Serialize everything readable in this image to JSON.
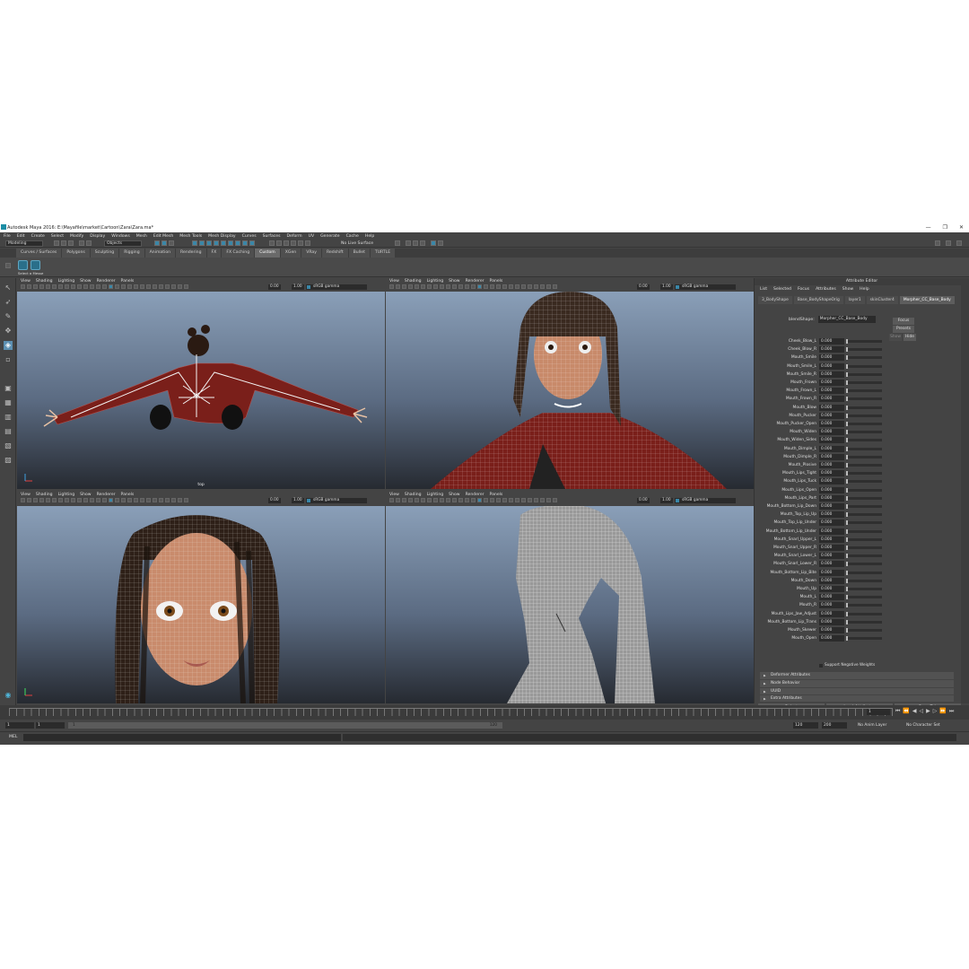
{
  "window": {
    "title": "Autodesk Maya 2016: E:\\Mayafile\\market\\Cartoon\\Zara\\Zara.ma*",
    "controls": [
      "—",
      "❐",
      "✕"
    ]
  },
  "menubar": [
    "File",
    "Edit",
    "Create",
    "Select",
    "Modify",
    "Display",
    "Windows",
    "Mesh",
    "Edit Mesh",
    "Mesh Tools",
    "Mesh Display",
    "Curves",
    "Surfaces",
    "Deform",
    "UV",
    "Generate",
    "Cache",
    "Help"
  ],
  "status": {
    "mode": "Modeling",
    "selection_mode": "Objects",
    "live_surface": "No Live Surface"
  },
  "shelf_tabs": [
    "Curves / Surfaces",
    "Polygons",
    "Sculpting",
    "Rigging",
    "Animation",
    "Rendering",
    "FX",
    "FX Caching",
    "Custom",
    "XGen",
    "VRay",
    "Redshift",
    "Bullet",
    "TURTLE"
  ],
  "shelf_active": "Custom",
  "shelf_button_label": "Select a Messe",
  "viewport_menu": [
    "View",
    "Shading",
    "Lighting",
    "Show",
    "Renderer",
    "Panels"
  ],
  "viewport_values": {
    "near": "0.00",
    "far": "1.00",
    "color_space": "sRGB gamma"
  },
  "viewports": [
    {
      "name": "top",
      "camera_label": "top"
    },
    {
      "name": "persp",
      "camera_label": ""
    },
    {
      "name": "front",
      "camera_label": ""
    },
    {
      "name": "side",
      "camera_label": ""
    }
  ],
  "attribute_editor": {
    "title": "Attribute Editor",
    "menu": [
      "List",
      "Selected",
      "Focus",
      "Attributes",
      "Show",
      "Help"
    ],
    "tabs": [
      "3_BodyShape",
      "Base_BodyShapeOrig",
      "layer1",
      "skinCluster4",
      "Morpher_CC_Base_Body"
    ],
    "active_tab": "Morpher_CC_Base_Body",
    "blendshape_label": "blendShape:",
    "blendshape_value": "Morpher_CC_Base_Body",
    "buttons": {
      "focus": "Focus",
      "presets": "Presets",
      "show": "Show",
      "hide": "Hide"
    },
    "targets": [
      {
        "name": "Cheek_Blow_L",
        "value": "0.000"
      },
      {
        "name": "Cheek_Blow_R",
        "value": "0.000"
      },
      {
        "name": "Mouth_Smile",
        "value": "0.000"
      },
      {
        "name": "Mouth_Smile_L",
        "value": "0.000"
      },
      {
        "name": "Mouth_Smile_R",
        "value": "0.000"
      },
      {
        "name": "Mouth_Frown",
        "value": "0.000"
      },
      {
        "name": "Mouth_Frown_L",
        "value": "0.000"
      },
      {
        "name": "Mouth_Frown_R",
        "value": "0.000"
      },
      {
        "name": "Mouth_Blow",
        "value": "0.000"
      },
      {
        "name": "Mouth_Pucker",
        "value": "0.000"
      },
      {
        "name": "Mouth_Pucker_Open",
        "value": "0.000"
      },
      {
        "name": "Mouth_Widen",
        "value": "0.000"
      },
      {
        "name": "Mouth_Widen_Sides",
        "value": "0.000"
      },
      {
        "name": "Mouth_Dimple_L",
        "value": "0.000"
      },
      {
        "name": "Mouth_Dimple_R",
        "value": "0.000"
      },
      {
        "name": "Mouth_Plosive",
        "value": "0.000"
      },
      {
        "name": "Mouth_Lips_Tight",
        "value": "0.000"
      },
      {
        "name": "Mouth_Lips_Tuck",
        "value": "0.000"
      },
      {
        "name": "Mouth_Lips_Open",
        "value": "0.000"
      },
      {
        "name": "Mouth_Lips_Part",
        "value": "0.000"
      },
      {
        "name": "Mouth_Bottom_Lip_Down",
        "value": "0.000"
      },
      {
        "name": "Mouth_Top_Lip_Up",
        "value": "0.000"
      },
      {
        "name": "Mouth_Top_Lip_Under",
        "value": "0.000"
      },
      {
        "name": "Mouth_Bottom_Lip_Under",
        "value": "0.000"
      },
      {
        "name": "Mouth_Snarl_Upper_L",
        "value": "0.000"
      },
      {
        "name": "Mouth_Snarl_Upper_R",
        "value": "0.000"
      },
      {
        "name": "Mouth_Snarl_Lower_L",
        "value": "0.000"
      },
      {
        "name": "Mouth_Snarl_Lower_R",
        "value": "0.000"
      },
      {
        "name": "Mouth_Bottom_Lip_Bite",
        "value": "0.000"
      },
      {
        "name": "Mouth_Down",
        "value": "0.000"
      },
      {
        "name": "Mouth_Up",
        "value": "0.000"
      },
      {
        "name": "Mouth_L",
        "value": "0.000"
      },
      {
        "name": "Mouth_R",
        "value": "0.000"
      },
      {
        "name": "Mouth_Lips_Jaw_Adjust",
        "value": "0.000"
      },
      {
        "name": "Mouth_Bottom_Lip_Trans",
        "value": "0.000"
      },
      {
        "name": "Mouth_Skewer",
        "value": "0.000"
      },
      {
        "name": "Mouth_Open",
        "value": "0.000"
      }
    ],
    "support_negative": "Support Negative Weights",
    "sections": [
      "Deformer Attributes",
      "Node Behavior",
      "UUID",
      "Extra Attributes"
    ],
    "bottom_buttons": [
      "Select",
      "Load Attributes",
      "Copy Tab"
    ]
  },
  "timeline": {
    "current_frame": "1",
    "range_start": "1",
    "range_inner_start": "1",
    "range_bar_start": "1",
    "range_bar_end": "120",
    "range_end": "120",
    "range_outer_end": "200",
    "anim_layer": "No Anim Layer",
    "character_set": "No Character Set"
  },
  "command_line": {
    "label": "MEL"
  }
}
